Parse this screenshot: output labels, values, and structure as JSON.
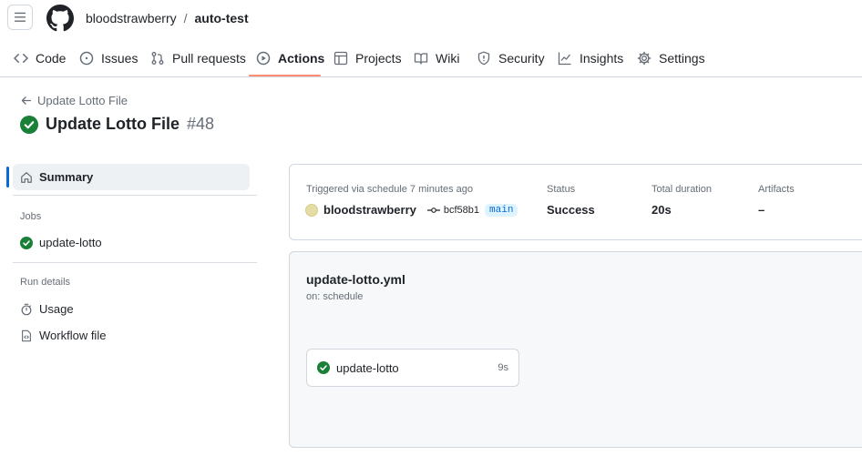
{
  "header": {
    "owner": "bloodstrawberry",
    "separator": "/",
    "repo": "auto-test"
  },
  "tabs": [
    {
      "label": "Code",
      "icon": "code-icon"
    },
    {
      "label": "Issues",
      "icon": "issue-opened-icon"
    },
    {
      "label": "Pull requests",
      "icon": "git-pull-request-icon"
    },
    {
      "label": "Actions",
      "icon": "play-icon",
      "active": true
    },
    {
      "label": "Projects",
      "icon": "table-icon"
    },
    {
      "label": "Wiki",
      "icon": "book-icon"
    },
    {
      "label": "Security",
      "icon": "shield-icon"
    },
    {
      "label": "Insights",
      "icon": "graph-icon"
    },
    {
      "label": "Settings",
      "icon": "gear-icon"
    }
  ],
  "run": {
    "back_label": "Update Lotto File",
    "title": "Update Lotto File",
    "number": "#48"
  },
  "sidebar": {
    "summary_label": "Summary",
    "jobs_heading": "Jobs",
    "job_label": "update-lotto",
    "run_details_heading": "Run details",
    "usage_label": "Usage",
    "workflow_file_label": "Workflow file"
  },
  "summary": {
    "trigger_text": "Triggered via schedule 7 minutes ago",
    "user": "bloodstrawberry",
    "commit": "bcf58b1",
    "branch": "main",
    "status_label": "Status",
    "status_value": "Success",
    "duration_label": "Total duration",
    "duration_value": "20s",
    "artifacts_label": "Artifacts",
    "artifacts_value": "–"
  },
  "workflow": {
    "file": "update-lotto.yml",
    "on": "on: schedule",
    "job_name": "update-lotto",
    "job_time": "9s"
  },
  "colors": {
    "success": "#1a7f37",
    "accent": "#0969da",
    "tab_underline": "#fd8c73"
  }
}
